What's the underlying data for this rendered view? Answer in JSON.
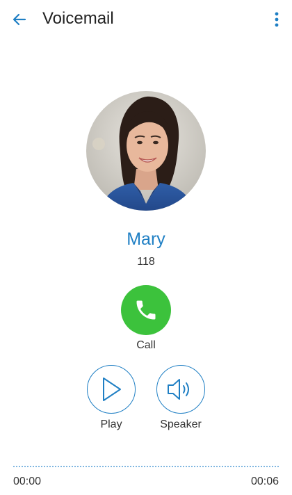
{
  "header": {
    "title": "Voicemail",
    "back_icon": "arrow-left-icon",
    "menu_icon": "more-vert-icon"
  },
  "contact": {
    "name": "Mary",
    "number": "118",
    "avatar": "contact-photo"
  },
  "actions": {
    "call_label": "Call",
    "play_label": "Play",
    "speaker_label": "Speaker"
  },
  "playback": {
    "current_time": "00:00",
    "duration": "00:06",
    "progress": 0
  },
  "colors": {
    "accent": "#1f7fc4",
    "call_green": "#3cc23c",
    "text": "#333333"
  }
}
